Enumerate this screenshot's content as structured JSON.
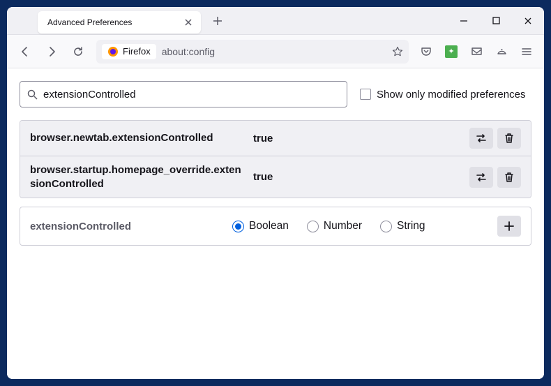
{
  "tab": {
    "title": "Advanced Preferences"
  },
  "urlbar": {
    "identity": "Firefox",
    "url": "about:config"
  },
  "search": {
    "value": "extensionControlled",
    "checkbox_label": "Show only modified preferences"
  },
  "prefs": [
    {
      "name": "browser.newtab.extensionControlled",
      "value": "true"
    },
    {
      "name": "browser.startup.homepage_override.extensionControlled",
      "value": "true"
    }
  ],
  "new_pref": {
    "name": "extensionControlled",
    "types": [
      "Boolean",
      "Number",
      "String"
    ],
    "selected": 0
  }
}
